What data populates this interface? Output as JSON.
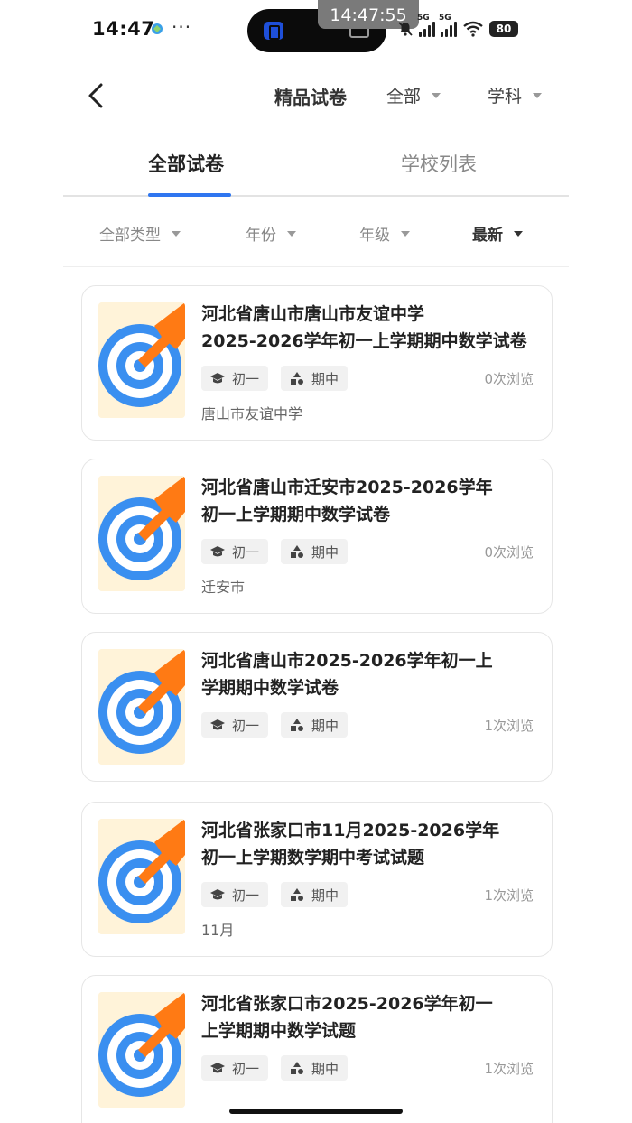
{
  "status_bar": {
    "time": "14:47",
    "dots": "···",
    "overlay_time": "14:47:55",
    "network_1": "5G",
    "network_2": "5G",
    "battery": "80"
  },
  "header": {
    "title": "精品试卷",
    "filter_all": "全部",
    "filter_subject": "学科"
  },
  "tabs": [
    {
      "label": "全部试卷",
      "active": true
    },
    {
      "label": "学校列表",
      "active": false
    }
  ],
  "filters": [
    {
      "label": "全部类型",
      "active": false
    },
    {
      "label": "年份",
      "active": false
    },
    {
      "label": "年级",
      "active": false
    },
    {
      "label": "最新",
      "active": true
    }
  ],
  "papers": [
    {
      "title_line1": "河北省唐山市唐山市友谊中学",
      "title_line2": "2025-2026学年初一上学期期中数学试卷",
      "grade": "初一",
      "term": "期中",
      "views": "0次浏览",
      "school": "唐山市友谊中学"
    },
    {
      "title_line1": "河北省唐山市迁安市2025-2026学年",
      "title_line2": "初一上学期期中数学试卷",
      "grade": "初一",
      "term": "期中",
      "views": "0次浏览",
      "school": "迁安市"
    },
    {
      "title_line1": "河北省唐山市2025-2026学年初一上",
      "title_line2": "学期期中数学试卷",
      "grade": "初一",
      "term": "期中",
      "views": "1次浏览",
      "school": ""
    },
    {
      "title_line1": "河北省张家口市11月2025-2026学年",
      "title_line2": "初一上学期数学期中考试试题",
      "grade": "初一",
      "term": "期中",
      "views": "1次浏览",
      "school": "11月"
    },
    {
      "title_line1": "河北省张家口市2025-2026学年初一",
      "title_line2": "上学期期中数学试题",
      "grade": "初一",
      "term": "期中",
      "views": "1次浏览",
      "school": ""
    }
  ],
  "colors": {
    "accent": "#2f76f0",
    "target_blue": "#3a8ff0",
    "arrow_orange": "#ff7a14",
    "thumb_bg": "#fff3d9"
  }
}
